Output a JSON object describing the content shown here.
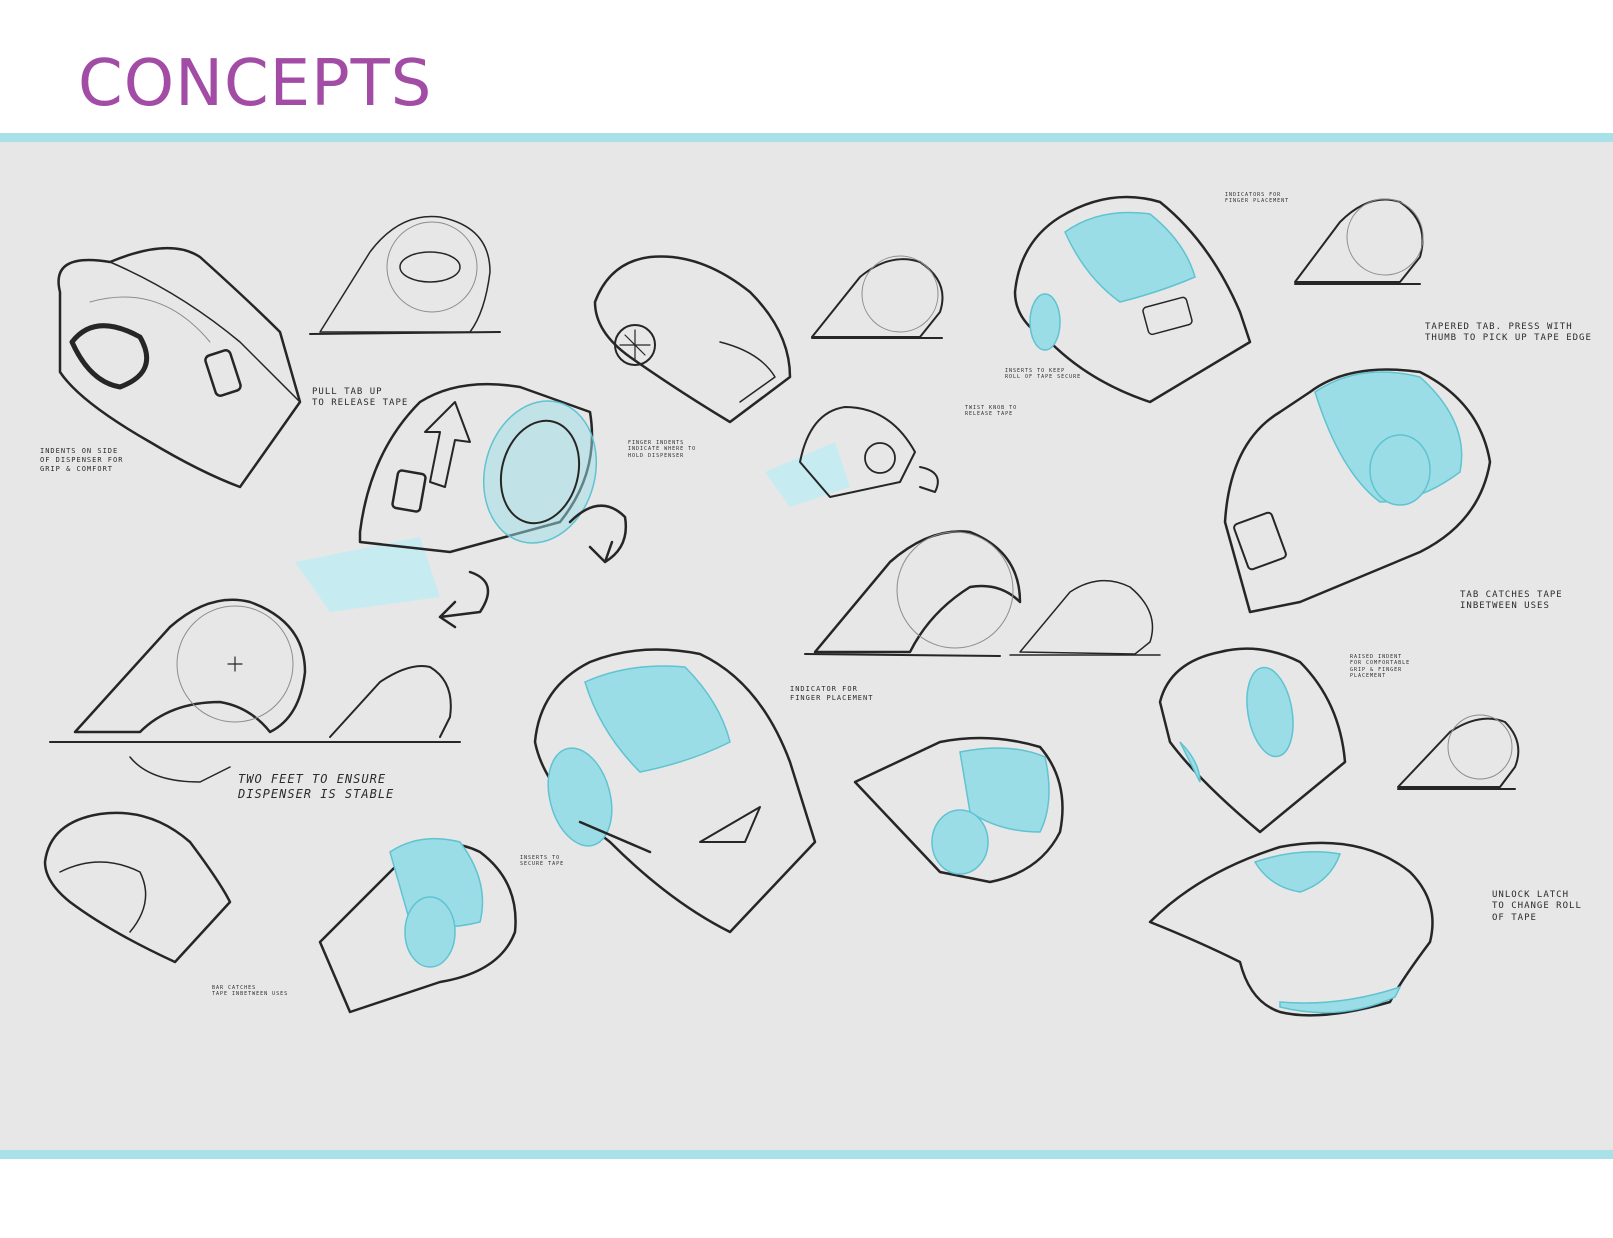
{
  "title": "CONCEPTS",
  "colors": {
    "title": "#a24ca5",
    "accent_rule": "#a8e1e8",
    "panel": "#e7e7e7",
    "sketch_blue": "#9bdde6",
    "ink": "#262626"
  },
  "annotations": {
    "indents_side": "INDENTS ON SIDE\nOF DISPENSER FOR\nGRIP & COMFORT",
    "pull_tab": "PULL TAB UP\nTO RELEASE TAPE",
    "finger_indents": "FINGER INDENTS\nINDICATE WHERE TO\nHOLD DISPENSER",
    "twist_knob": "TWIST KNOB TO\nRELEASE TAPE",
    "indicators_top": "INDICATORS FOR\nFINGER PLACEMENT",
    "inserts_keep": "INSERTS TO KEEP\nROLL OF TAPE SECURE",
    "tapered_tab": "TAPERED TAB. PRESS WITH\nTHUMB TO PICK UP TAPE EDGE",
    "tab_catches": "TAB CATCHES TAPE\nINBETWEEN USES",
    "two_feet": "TWO FEET TO ENSURE\nDISPENSER IS STABLE",
    "indicator_finger": "INDICATOR FOR\nFINGER PLACEMENT",
    "inserts_secure": "INSERTS TO\nSECURE TAPE",
    "raised_indent": "RAISED INDENT\nFOR COMFORTABLE\nGRIP & FINGER\nPLACEMENT",
    "bar_catches": "BAR CATCHES\nTAPE INBETWEEN USES",
    "unlock_latch": "UNLOCK LATCH\nTO CHANGE ROLL\nOF TAPE"
  }
}
